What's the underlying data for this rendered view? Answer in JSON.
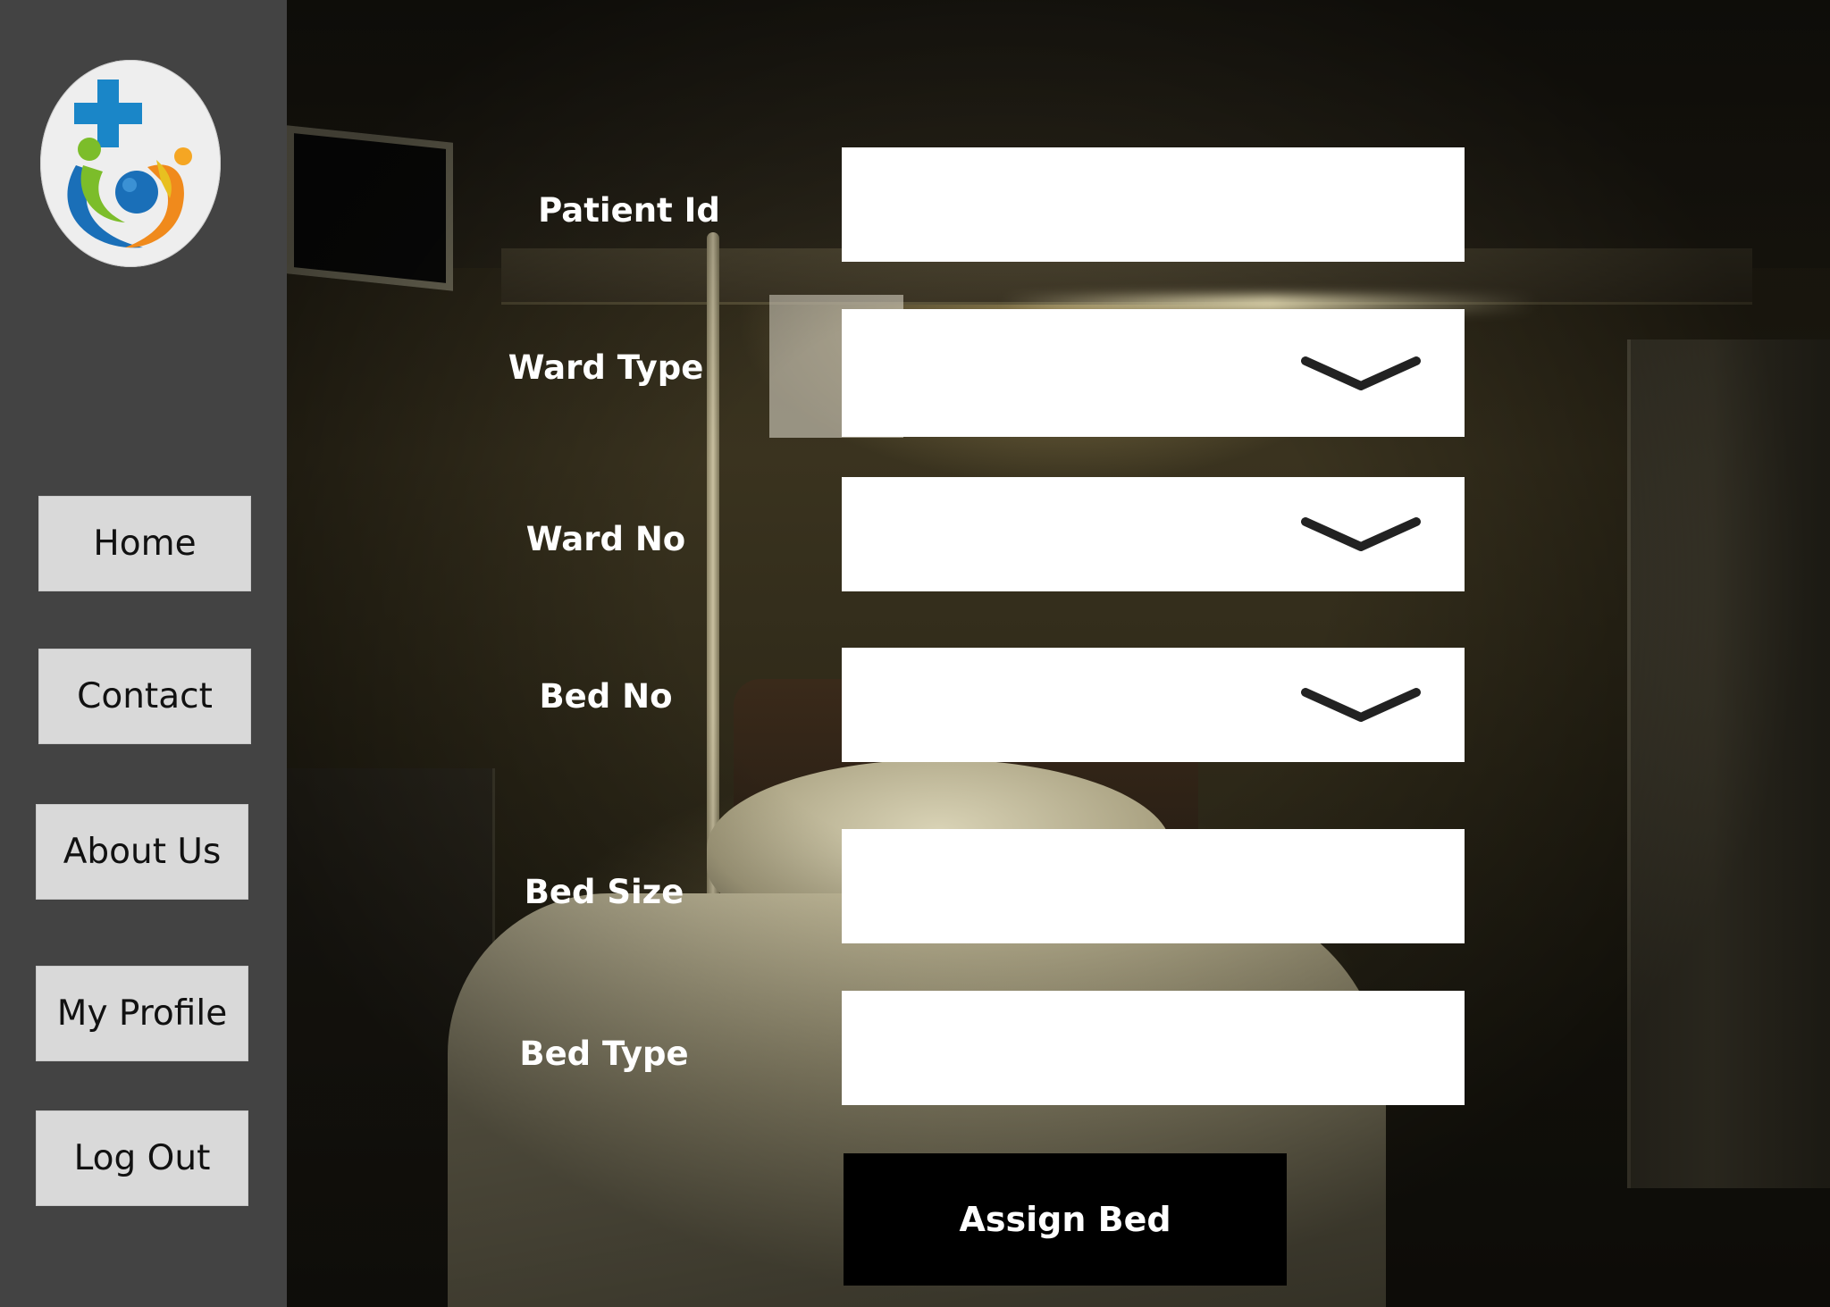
{
  "sidebar": {
    "items": [
      {
        "label": "Home"
      },
      {
        "label": "Contact"
      },
      {
        "label": "About Us"
      },
      {
        "label": "My Profile"
      },
      {
        "label": "Log Out"
      }
    ]
  },
  "form": {
    "patient_id": {
      "label": "Patient Id",
      "value": ""
    },
    "ward_type": {
      "label": "Ward Type",
      "value": ""
    },
    "ward_no": {
      "label": "Ward No",
      "value": ""
    },
    "bed_no": {
      "label": "Bed No",
      "value": ""
    },
    "bed_size": {
      "label": "Bed Size",
      "value": ""
    },
    "bed_type": {
      "label": "Bed Type",
      "value": ""
    },
    "submit_label": "Assign Bed"
  },
  "colors": {
    "sidebar_bg": "#434343",
    "nav_button_bg": "#d9d9d9",
    "field_bg": "#ffffff",
    "submit_bg": "#000000",
    "label_text": "#ffffff"
  },
  "icons": {
    "logo": "hospital-cross-family-logo-icon",
    "dropdown": "chevron-down-icon"
  }
}
